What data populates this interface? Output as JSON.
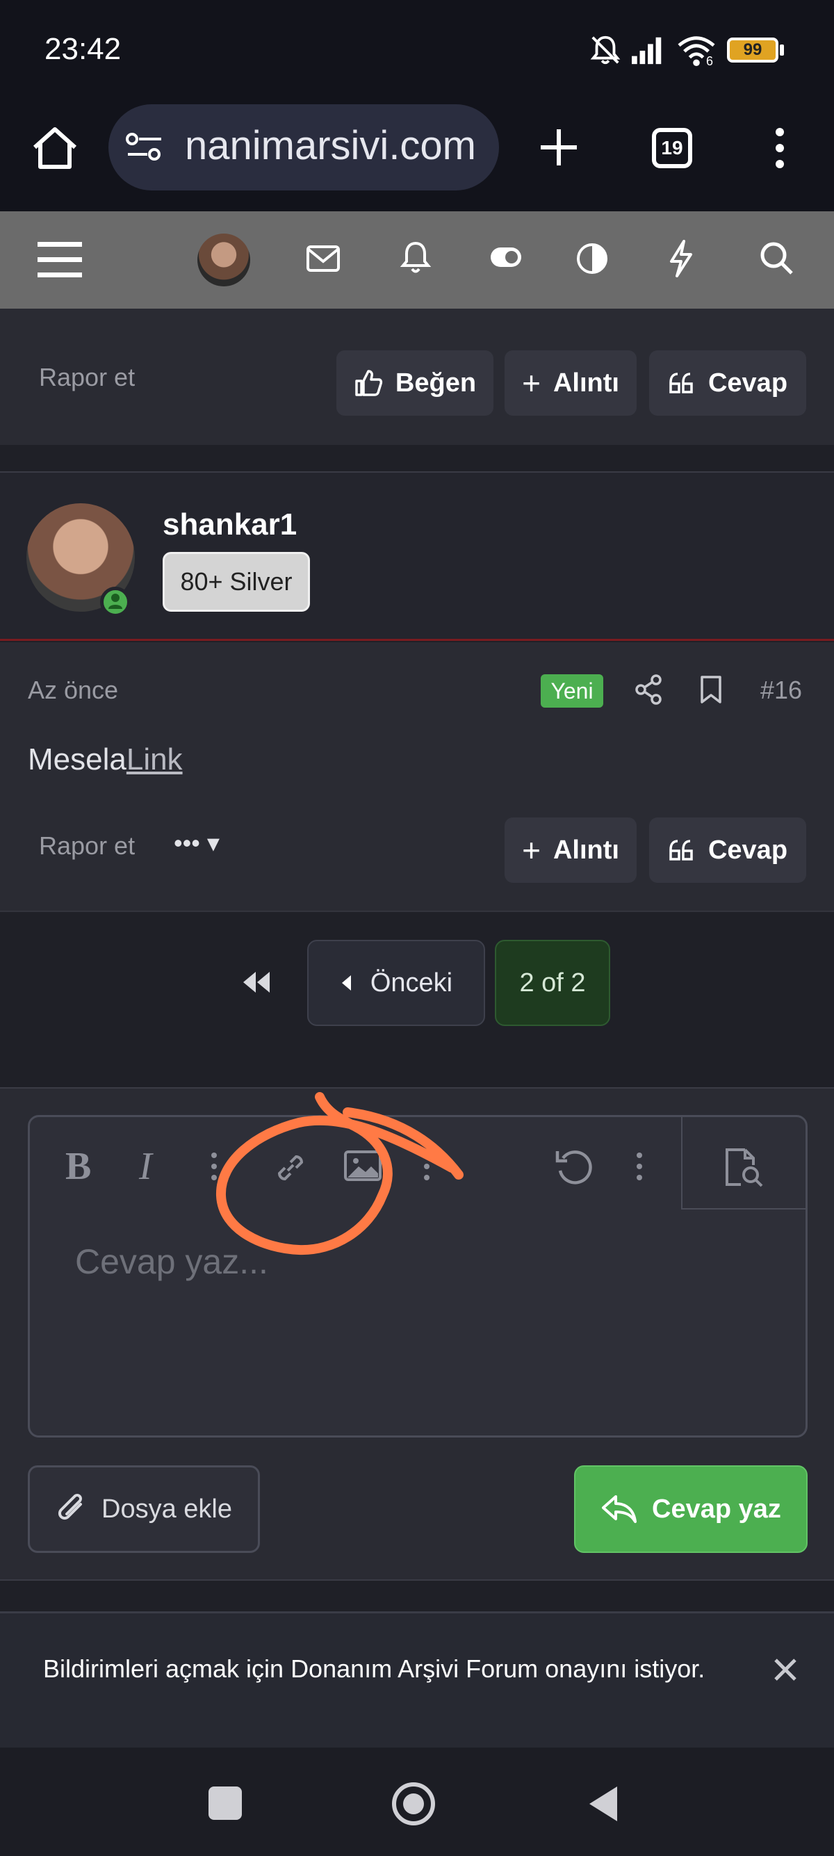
{
  "status_bar": {
    "time": "23:42",
    "battery": "99",
    "signal_label": "6"
  },
  "browser": {
    "url": "nanimarsivi.com",
    "tab_count": "19"
  },
  "prev_post": {
    "report": "Rapor et",
    "like": "Beğen",
    "quote": "Alıntı",
    "reply": "Cevap"
  },
  "user": {
    "name": "shankar1",
    "badge": "80+ Silver"
  },
  "post": {
    "time": "Az önce",
    "new_badge": "Yeni",
    "number": "#16",
    "content_text": "Mesela",
    "content_link": "Link",
    "report": "Rapor et",
    "quote": "Alıntı",
    "reply": "Cevap"
  },
  "pagination": {
    "prev": "Önceki",
    "current": "2 of 2"
  },
  "editor": {
    "placeholder": "Cevap yaz...",
    "attach": "Dosya ekle",
    "submit": "Cevap yaz"
  },
  "notification": {
    "text": "Bildirimleri açmak için Donanım Arşivi Forum onayını istiyor."
  },
  "colors": {
    "accent_green": "#4caf50",
    "annotation_orange": "#ff7a45"
  }
}
